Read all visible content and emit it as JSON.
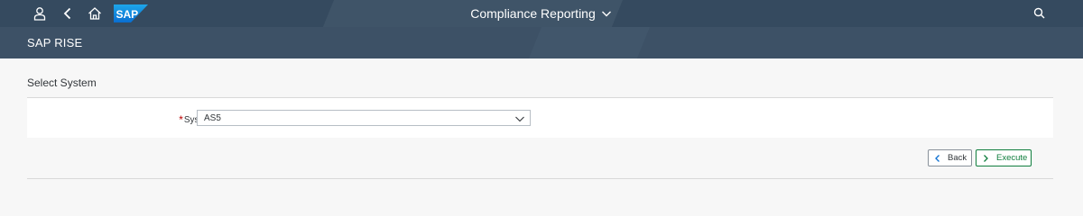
{
  "shell": {
    "title": "Compliance Reporting",
    "logo_text": "SAP",
    "icons": [
      "user-icon",
      "back-icon",
      "home-icon",
      "search-icon"
    ]
  },
  "subheader": {
    "title": "SAP RISE"
  },
  "section": {
    "title": "Select System"
  },
  "form": {
    "required_marker": "*",
    "system_label": "System:",
    "system_value": "AS5"
  },
  "actions": {
    "back_label": "Back",
    "execute_label": "Execute"
  },
  "colors": {
    "shell_bg": "#354a5f",
    "subheader_bg": "#3d5166",
    "accent_blue": "#0a6ed1",
    "execute_green": "#107e3e",
    "required_red": "#bb0000"
  }
}
